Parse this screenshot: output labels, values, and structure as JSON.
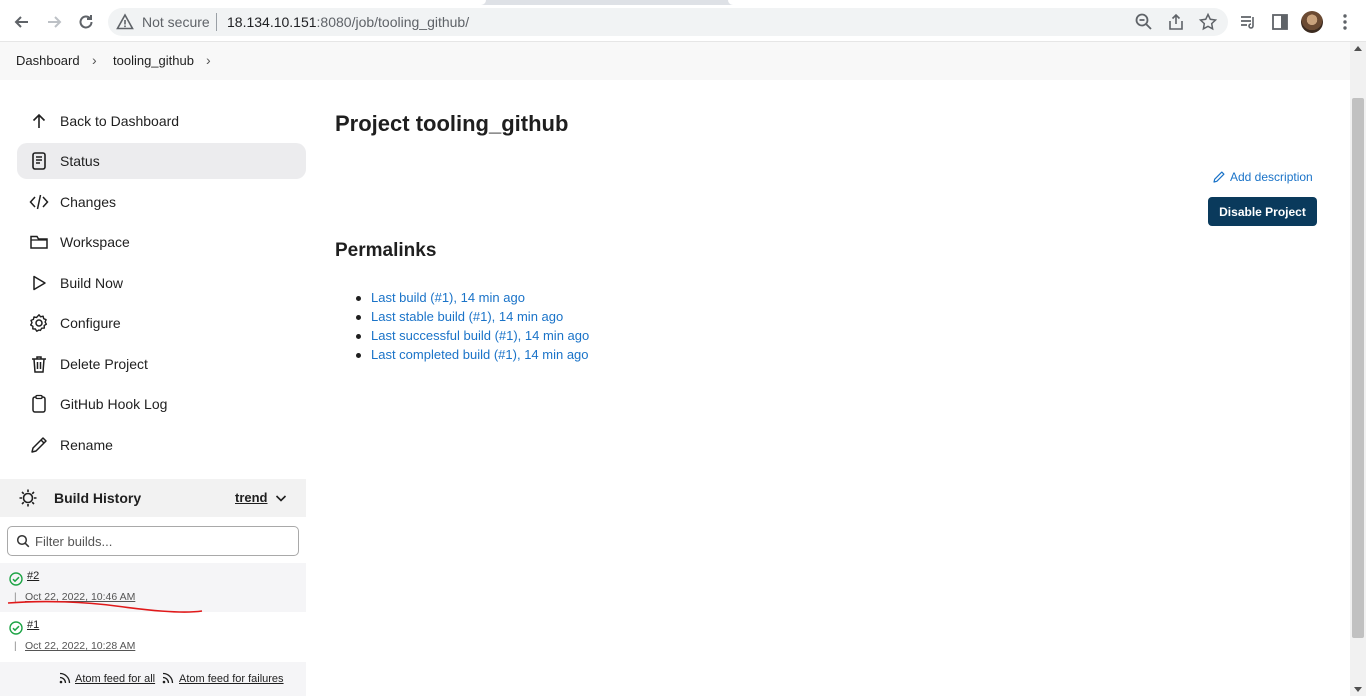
{
  "browser": {
    "security_label": "Not secure",
    "url_host": "18.134.10.151",
    "url_rest": ":8080/job/tooling_github/"
  },
  "breadcrumb": {
    "items": [
      "Dashboard",
      "tooling_github"
    ]
  },
  "sidebar": {
    "tasks": [
      {
        "label": "Back to Dashboard",
        "icon": "arrow-up-icon"
      },
      {
        "label": "Status",
        "icon": "status-doc-icon"
      },
      {
        "label": "Changes",
        "icon": "code-icon"
      },
      {
        "label": "Workspace",
        "icon": "folder-icon"
      },
      {
        "label": "Build Now",
        "icon": "play-icon"
      },
      {
        "label": "Configure",
        "icon": "gear-icon"
      },
      {
        "label": "Delete Project",
        "icon": "trash-icon"
      },
      {
        "label": "GitHub Hook Log",
        "icon": "clipboard-icon"
      },
      {
        "label": "Rename",
        "icon": "pencil-icon"
      }
    ]
  },
  "build_history": {
    "title": "Build History",
    "trend_label": "trend",
    "filter_placeholder": "Filter builds...",
    "builds": [
      {
        "number": "#2",
        "date": "Oct 22, 2022, 10:46 AM",
        "status": "success"
      },
      {
        "number": "#1",
        "date": "Oct 22, 2022, 10:28 AM",
        "status": "success"
      }
    ],
    "feed_all": "Atom feed for all",
    "feed_failures": "Atom feed for failures"
  },
  "main": {
    "title": "Project tooling_github",
    "add_description": "Add description",
    "disable_button": "Disable Project",
    "permalinks_title": "Permalinks",
    "permalinks": [
      "Last build (#1), 14 min ago",
      "Last stable build (#1), 14 min ago",
      "Last successful build (#1), 14 min ago",
      "Last completed build (#1), 14 min ago"
    ]
  },
  "colors": {
    "link": "#1a73c8",
    "button_bg": "#0a3a5c",
    "success": "#1ea446",
    "annotation": "#e0191a"
  }
}
